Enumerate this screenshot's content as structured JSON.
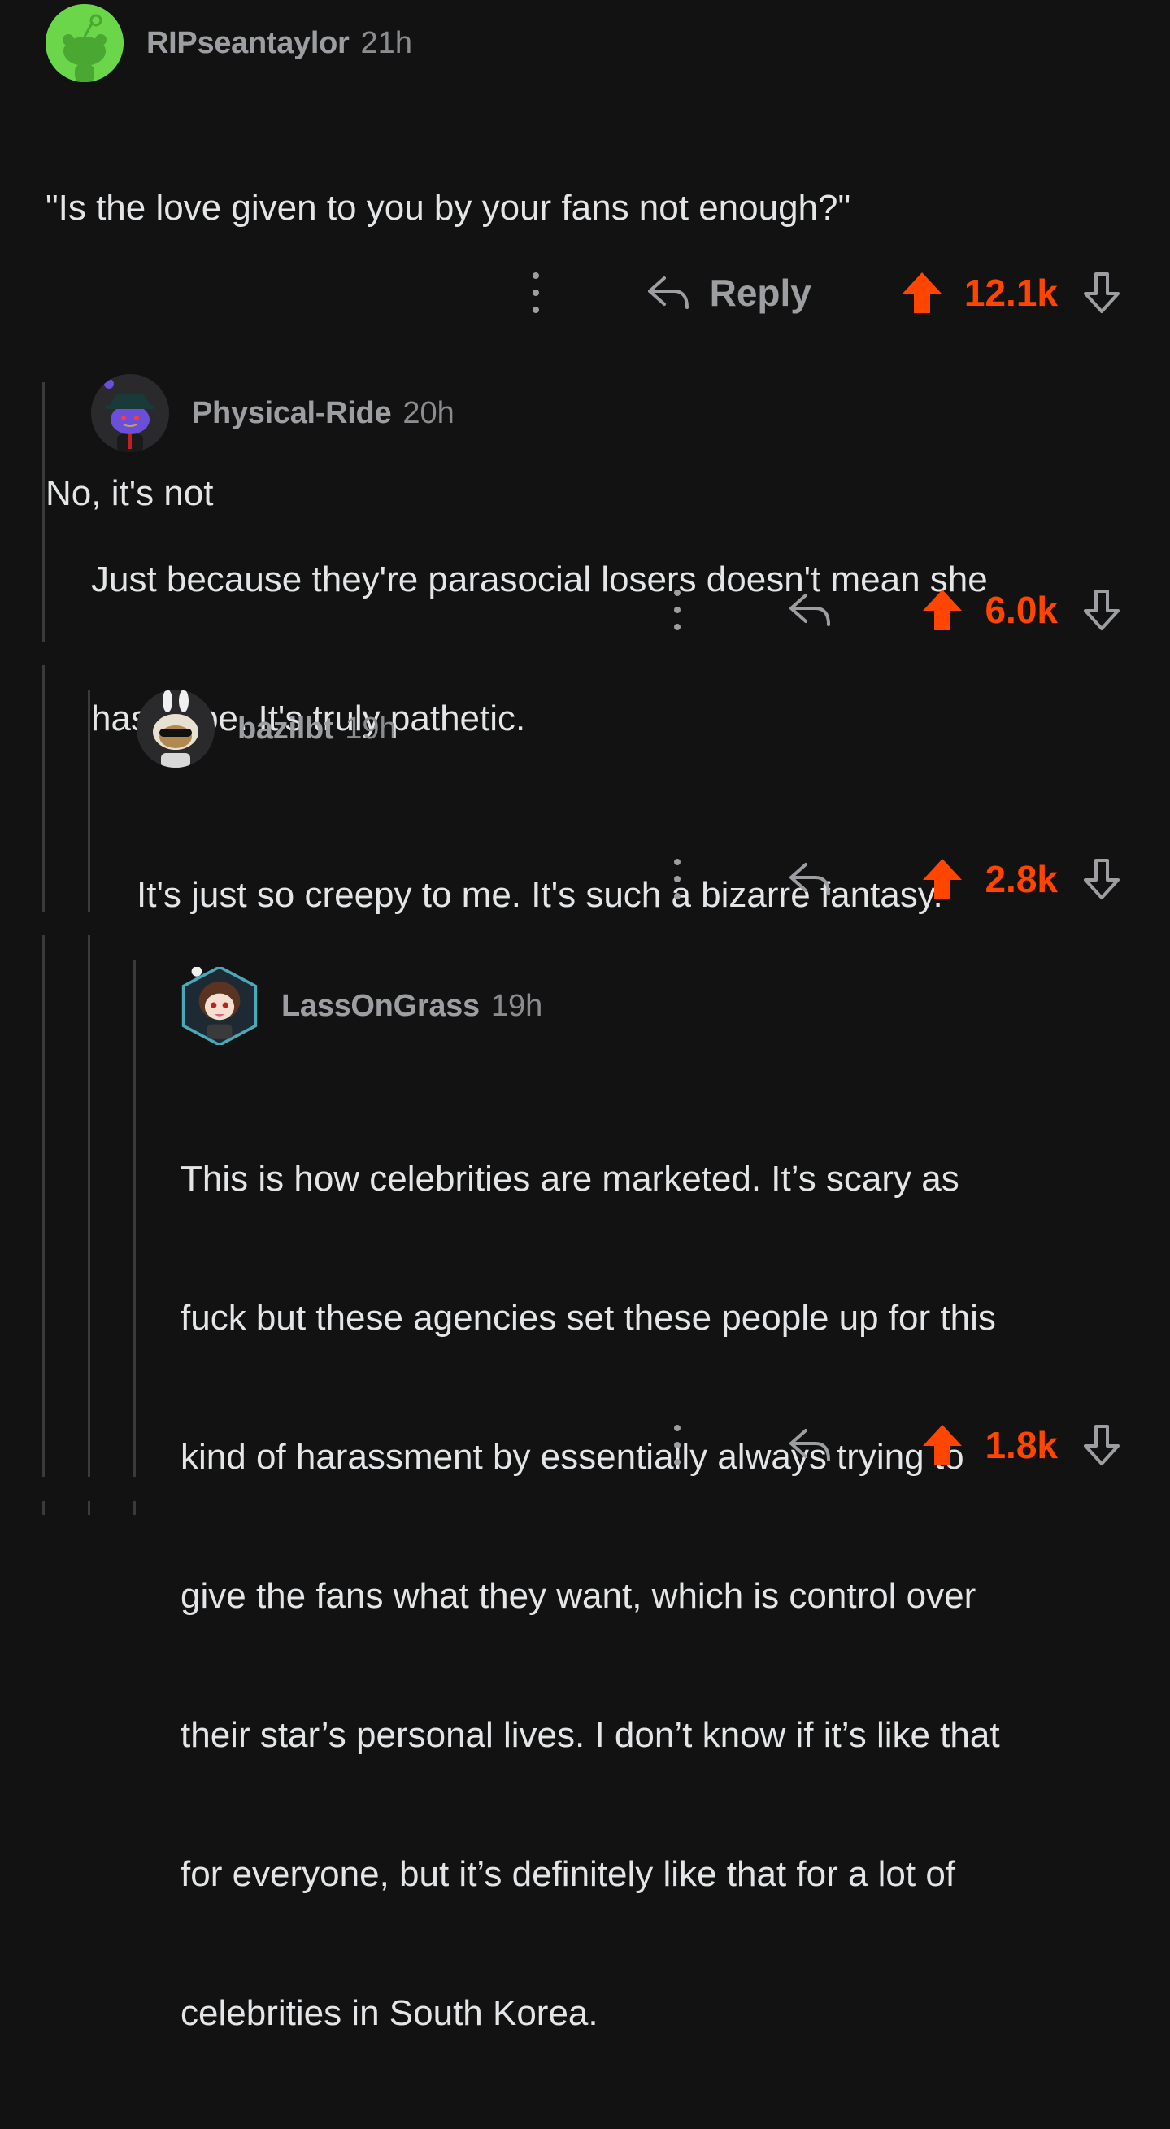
{
  "comments": [
    {
      "username": "RIPseantaylor",
      "time": "21h",
      "body": [
        "\"Is the love given to you by your fans not enough?\"",
        "",
        "No, it's not"
      ],
      "reply_label": "Reply",
      "score": "12.1k",
      "avatar_icon": "snoo-green-avatar-icon"
    },
    {
      "username": "Physical-Ride",
      "time": "20h",
      "body": [
        "Just because they're parasocial losers doesn't mean she",
        "has to be. It's truly pathetic."
      ],
      "score": "6.0k",
      "avatar_icon": "snoo-detective-avatar-icon"
    },
    {
      "username": "bazilbt",
      "time": "19h",
      "body": [
        "It's just so creepy to me. It's such a bizarre fantasy."
      ],
      "score": "2.8k",
      "avatar_icon": "snoo-bunny-sunglasses-avatar-icon"
    },
    {
      "username": "LassOnGrass",
      "time": "19h",
      "body": [
        "This is how celebrities are marketed. It’s scary as",
        "fuck but these agencies set these people up for this",
        "kind of harassment by essentially always trying to",
        "give the fans what they want, which is control over",
        "their star’s personal lives. I don’t know if it’s like that",
        "for everyone, but it’s definitely like that for a lot of",
        "celebrities in South Korea."
      ],
      "score": "1.8k",
      "avatar_icon": "snoo-brunette-hexagon-avatar-icon"
    }
  ],
  "colors": {
    "background": "#121212",
    "upvote": "#ff4500",
    "muted": "#9c9ea1",
    "thread_line": "#3a3a3c"
  }
}
